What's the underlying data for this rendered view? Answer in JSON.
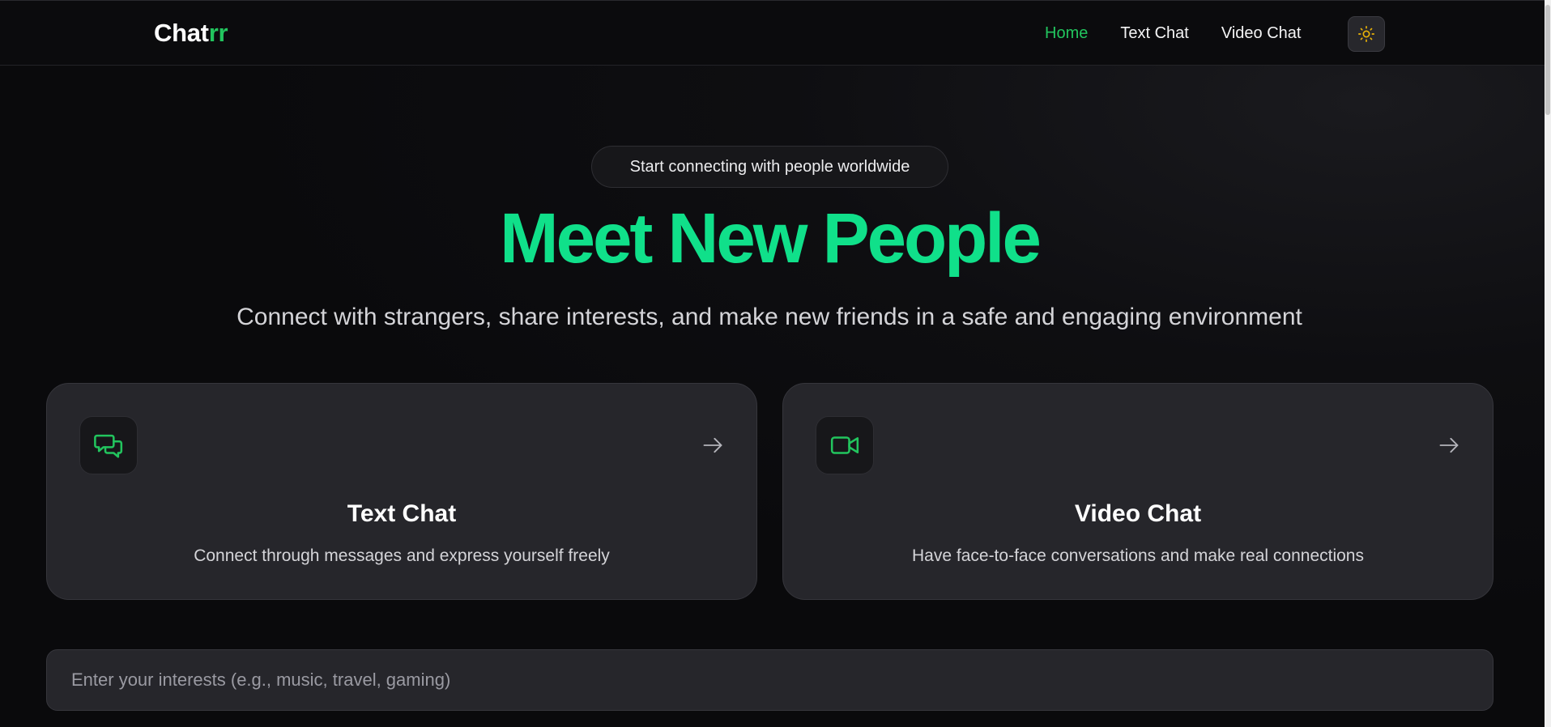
{
  "nav": {
    "logo_main": "Chat",
    "logo_accent": "rr",
    "links": [
      "Home",
      "Text Chat",
      "Video Chat"
    ],
    "active_link": "Home",
    "theme_icon": "sun-icon"
  },
  "hero": {
    "badge": "Start connecting with people worldwide",
    "title": "Meet New People",
    "subtitle": "Connect with strangers, share interests, and make new friends in a safe and engaging environment"
  },
  "cards": [
    {
      "icon": "chat-bubbles-icon",
      "title": "Text Chat",
      "description": "Connect through messages and express yourself freely"
    },
    {
      "icon": "video-camera-icon",
      "title": "Video Chat",
      "description": "Have face-to-face conversations and make real connections"
    }
  ],
  "interests": {
    "placeholder": "Enter your interests (e.g., music, travel, gaming)",
    "value": ""
  },
  "colors": {
    "accent": "#22c55e",
    "hero_title": "#10e08a",
    "background": "#0a0a0c",
    "card": "#26262b",
    "sun_icon": "#eab308"
  }
}
